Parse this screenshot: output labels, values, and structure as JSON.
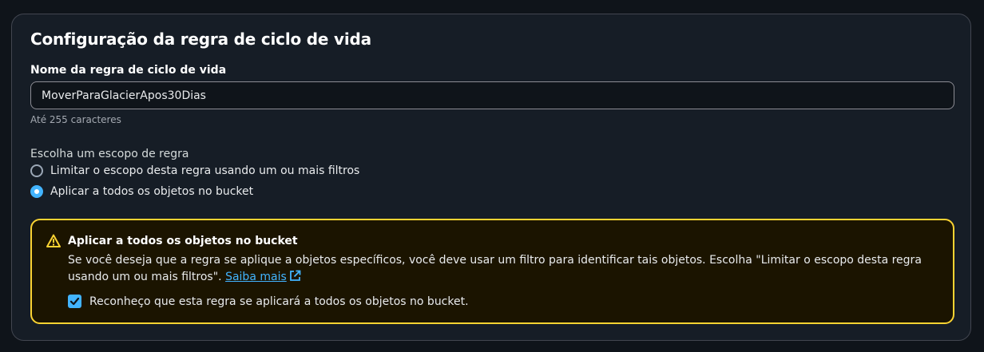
{
  "panel": {
    "title": "Configuração da regra de ciclo de vida"
  },
  "rule_name": {
    "label": "Nome da regra de ciclo de vida",
    "value": "MoverParaGlacierApos30Dias",
    "hint": "Até 255 caracteres"
  },
  "scope": {
    "label": "Escolha um escopo de regra",
    "options": [
      {
        "label": "Limitar o escopo desta regra usando um ou mais filtros",
        "selected": false
      },
      {
        "label": "Aplicar a todos os objetos no bucket",
        "selected": true
      }
    ]
  },
  "warning": {
    "icon": "warning-icon",
    "title": "Aplicar a todos os objetos no bucket",
    "body": "Se você deseja que a regra se aplique a objetos específicos, você deve usar um filtro para identificar tais objetos. Escolha \"Limitar o escopo desta regra usando um ou mais filtros\".",
    "link_label": "Saiba mais",
    "link_icon": "external-link-icon",
    "acknowledge_label": "Reconheço que esta regra se aplicará a todos os objetos no bucket.",
    "acknowledged": true
  },
  "colors": {
    "accent": "#42b4ff",
    "warning_border": "#fbd332",
    "panel_bg": "#161d26",
    "page_bg": "#0f141a"
  }
}
